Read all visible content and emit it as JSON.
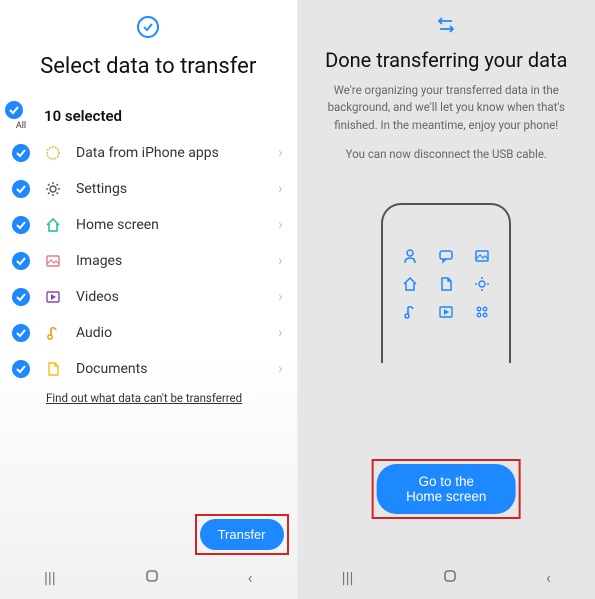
{
  "left": {
    "title": "Select data to transfer",
    "allLabel": "All",
    "selectedText": "10 selected",
    "items": [
      {
        "label": "Data from iPhone apps",
        "icon": "apps-icon",
        "color": "#c9c23c"
      },
      {
        "label": "Settings",
        "icon": "gear-icon",
        "color": "#555555"
      },
      {
        "label": "Home screen",
        "icon": "home-icon",
        "color": "#1abc9c"
      },
      {
        "label": "Images",
        "icon": "images-icon",
        "color": "#e07b7b"
      },
      {
        "label": "Videos",
        "icon": "videos-icon",
        "color": "#8e44ad"
      },
      {
        "label": "Audio",
        "icon": "audio-icon",
        "color": "#f39c12"
      },
      {
        "label": "Documents",
        "icon": "documents-icon",
        "color": "#f1c40f"
      }
    ],
    "link": "Find out what data can't be transferred",
    "transferBtn": "Transfer"
  },
  "right": {
    "title": "Done transferring your data",
    "sub1": "We're organizing your transferred data in the background, and we'll let you know when that's finished. In the meantime, enjoy your phone!",
    "sub2": "You can now disconnect the USB cable.",
    "homeBtn": "Go to the Home screen"
  }
}
